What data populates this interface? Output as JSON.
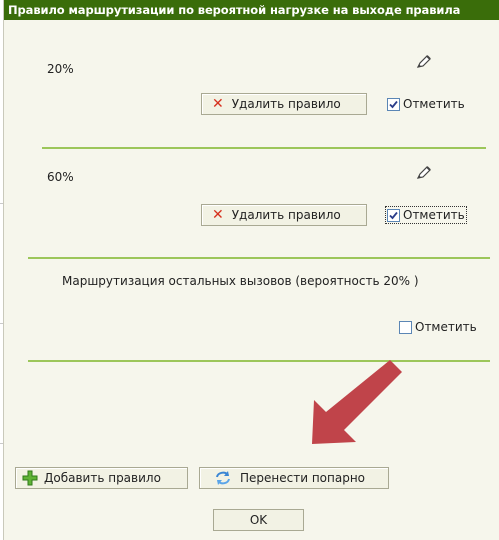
{
  "dialog": {
    "title": "Правило маршрутизации по вероятной нагрузке на выходе правила"
  },
  "rules": [
    {
      "percent": "20%",
      "delete_label": "Удалить правило",
      "mark_label": "Отметить",
      "checked": true
    },
    {
      "percent": "60%",
      "delete_label": "Удалить правило",
      "mark_label": "Отметить",
      "checked": true
    }
  ],
  "remaining": {
    "text": "Маршрутизация остальных вызовов (вероятность 20% )",
    "mark_label": "Отметить",
    "checked": false
  },
  "footer": {
    "add_rule_label": "Добавить правило",
    "swap_label": "Перенести попарно",
    "ok_label": "OK"
  },
  "colors": {
    "title_bg": "#3a6d0a",
    "divider": "#9cc65a",
    "arrow": "#c0444a",
    "delete_x": "#d6301e"
  },
  "icons": {
    "edit": "pencil-icon",
    "delete": "close-icon",
    "add": "plus-icon",
    "swap": "refresh-icon"
  }
}
